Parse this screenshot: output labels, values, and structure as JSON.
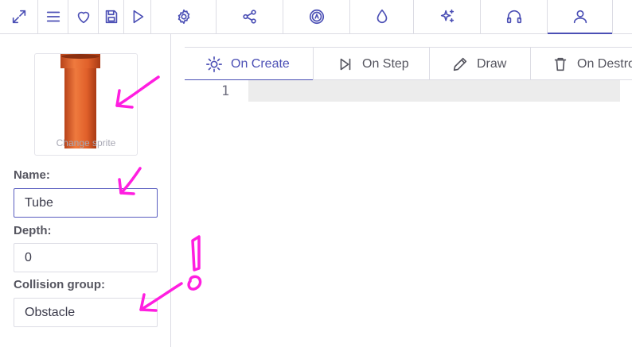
{
  "toolbar": {
    "buttons": [
      {
        "name": "maximize-icon"
      },
      {
        "name": "menu-icon"
      },
      {
        "name": "heart-icon"
      },
      {
        "name": "save-icon"
      },
      {
        "name": "play-icon"
      },
      {
        "name": "gear-icon"
      },
      {
        "name": "share-nodes-icon"
      },
      {
        "name": "compass-icon"
      },
      {
        "name": "droplet-icon"
      },
      {
        "name": "sparkles-icon"
      },
      {
        "name": "headphones-icon"
      },
      {
        "name": "user-icon",
        "active": true
      }
    ]
  },
  "sprite": {
    "caption": "Change sprite"
  },
  "fields": {
    "name_label": "Name:",
    "name_value": "Tube",
    "depth_label": "Depth:",
    "depth_value": "0",
    "collision_label": "Collision group:",
    "collision_value": "Obstacle"
  },
  "editor": {
    "tabs": [
      {
        "label": "On Create",
        "icon": "sun-icon",
        "active": true
      },
      {
        "label": "On Step",
        "icon": "skip-forward-icon"
      },
      {
        "label": "Draw",
        "icon": "pencil-icon"
      },
      {
        "label": "On Destroy",
        "icon": "trash-icon"
      }
    ],
    "line_number": "1"
  },
  "annotations": {
    "exclamation": "!"
  },
  "colors": {
    "accent": "#4b4fb5",
    "annotation": "#ff1ee0",
    "sprite": "#e0602a"
  }
}
